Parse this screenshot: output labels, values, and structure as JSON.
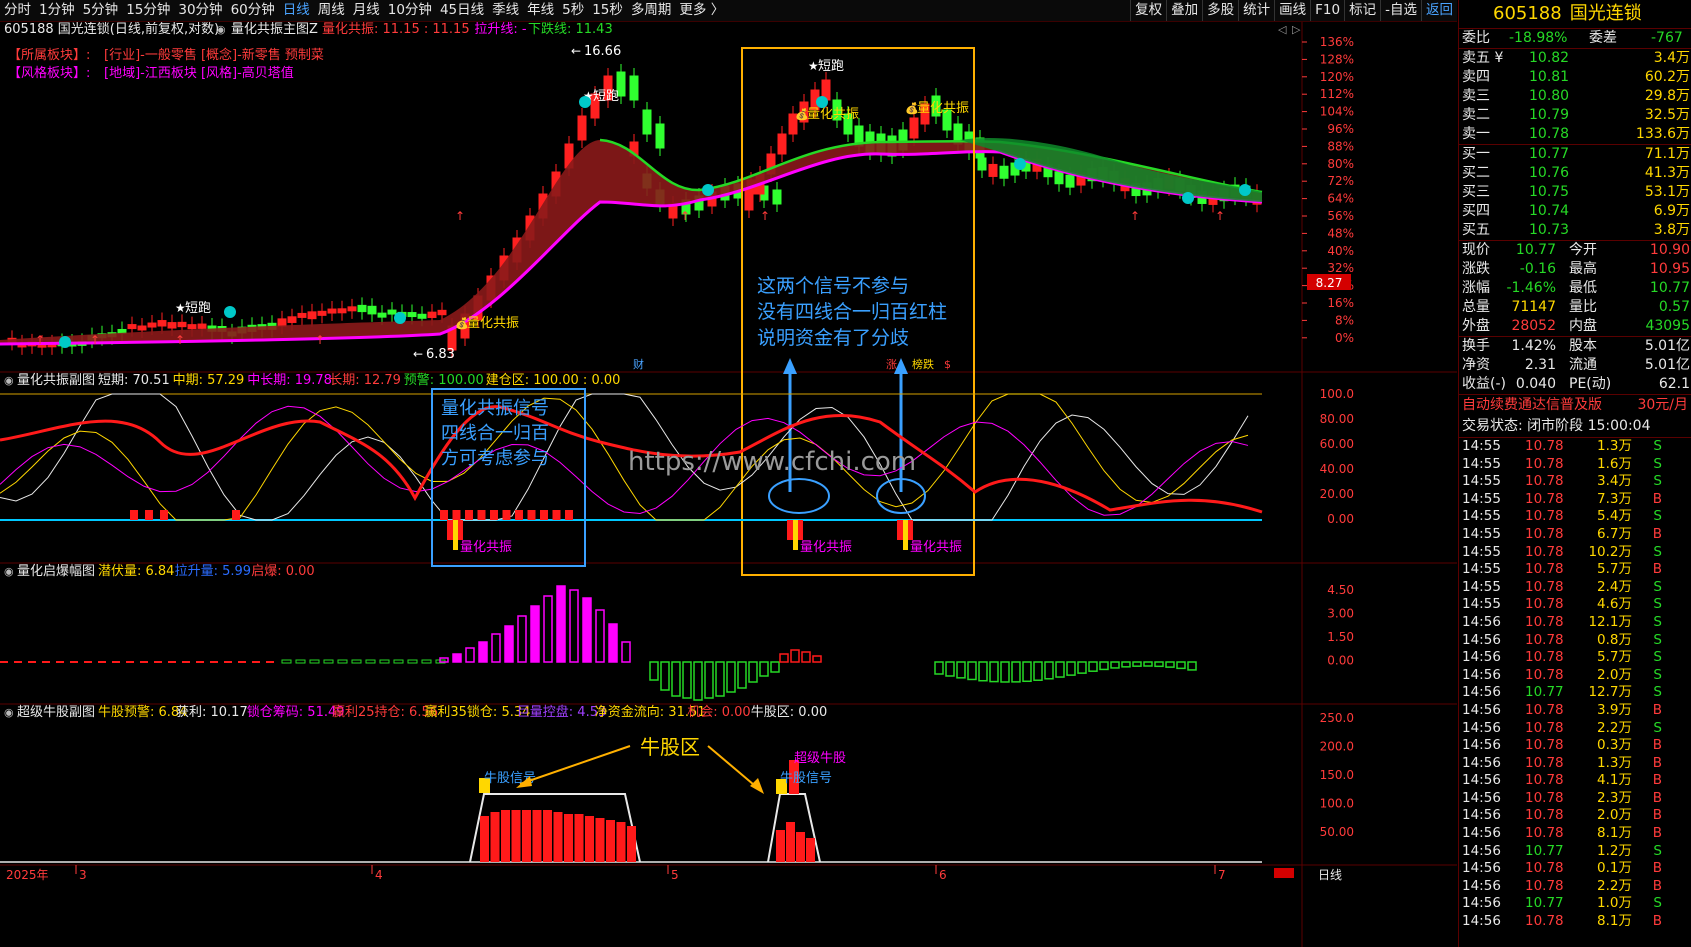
{
  "periods": [
    "分时",
    "1分钟",
    "5分钟",
    "15分钟",
    "30分钟",
    "60分钟",
    "日线",
    "周线",
    "月线",
    "10分钟",
    "45日线",
    "季线",
    "年线",
    "5秒",
    "15秒",
    "多周期",
    "更多 〉"
  ],
  "active_period": "日线",
  "top_buttons": [
    "复权",
    "叠加",
    "多股",
    "统计",
    "画线",
    "F10",
    "标记",
    "-自选",
    "返回"
  ],
  "main_pane": {
    "title": "605188 国光连锁(日线,前复权,对数)",
    "indicator": "量化共振主图Z",
    "params": [
      {
        "label": "量化共振: 11.15 : 11.15",
        "color": "#ff3b3b"
      },
      {
        "label": "拉升线: -",
        "color": "#ff00ff"
      },
      {
        "label": "下跌线: 11.43",
        "color": "#26d926"
      }
    ],
    "sector1_label": "【所属板块】:",
    "sector1_value": "[行业]-一般零售 [概念]-新零售 预制菜",
    "sector2_label": "【风格板块】:",
    "sector2_value": "[地域]-江西板块 [风格]-高贝塔值",
    "high_label": "16.66",
    "low_label": "6.83",
    "price_tag": "8.27",
    "pct_axis": [
      "136%",
      "128%",
      "120%",
      "112%",
      "104%",
      "96%",
      "88%",
      "80%",
      "72%",
      "64%",
      "56%",
      "48%",
      "40%",
      "32%",
      "24%",
      "16%",
      "8%",
      "0%"
    ],
    "annotations": {
      "duanpao": "短跑",
      "gongzhen": "量化共振",
      "cai": "财",
      "zhang": "涨",
      "bangdie": "榜跌"
    },
    "yellow_box_text": [
      "这两个信号不参与",
      "没有四线合一归百红柱",
      "说明资金有了分歧"
    ]
  },
  "pane2": {
    "name": "量化共振副图",
    "params": [
      {
        "label": "短期: 70.51",
        "color": "#e8e8e8"
      },
      {
        "label": "中期: 57.29",
        "color": "#ffd700"
      },
      {
        "label": "中长期: 19.78",
        "color": "#ff00ff"
      },
      {
        "label": "长期: 12.79",
        "color": "#ff3b3b"
      },
      {
        "label": "预警: 100.00",
        "color": "#26d926"
      },
      {
        "label": "建仓区: 100.00 : 0.00",
        "color": "#ffd700"
      }
    ],
    "axis": [
      "100.0",
      "80.00",
      "60.00",
      "40.00",
      "20.00",
      "0.00"
    ],
    "blue_box_text": [
      "量化共振信号",
      "四线合一归百",
      "方可考虑参与"
    ],
    "signal_label": "量化共振"
  },
  "pane3": {
    "name": "量化启爆幅图",
    "params": [
      {
        "label": "潜伏量: 6.84",
        "color": "#ffd700"
      },
      {
        "label": "拉升量: 5.99",
        "color": "#2b6cff"
      },
      {
        "label": "启爆: 0.00",
        "color": "#ff3b3b"
      }
    ],
    "axis": [
      "4.50",
      "3.00",
      "1.50",
      "0.00"
    ]
  },
  "pane4": {
    "name": "超级牛股副图",
    "params": [
      {
        "label": "牛股预警: 6.84",
        "color": "#ffd700"
      },
      {
        "label": "获利: 10.17",
        "color": "#e8e8e8"
      },
      {
        "label": "锁仓筹码: 51.49",
        "color": "#ff00ff"
      },
      {
        "label": "赢利25持仓: 6.56",
        "color": "#ff3b3b"
      },
      {
        "label": "赢利35锁仓: 5.34",
        "color": "#ffd700"
      },
      {
        "label": "巨量控盘: 4.53",
        "color": "#a040ff"
      },
      {
        "label": "净资金流向: 31.51",
        "color": "#ffd700"
      },
      {
        "label": "机会: 0.00",
        "color": "#ff3b3b"
      },
      {
        "label": "牛股区: 0.00",
        "color": "#e8e8e8"
      }
    ],
    "axis": [
      "250.0",
      "200.0",
      "150.0",
      "100.0",
      "50.00"
    ],
    "zone_label": "牛股区",
    "signal_label": "牛股信号",
    "super_label": "超级牛股"
  },
  "watermark": "https://www.cfchi.com",
  "x_axis": {
    "year": "2025年",
    "months": [
      "3",
      "4",
      "5",
      "6",
      "7"
    ],
    "mode": "日线"
  },
  "quote": {
    "code": "605188",
    "name": "国光连锁",
    "webi_label": "委比",
    "webi": "-18.98%",
    "weicha_label": "委差",
    "weicha": "-767",
    "asks": [
      {
        "label": "卖五 ¥",
        "price": "10.82",
        "vol": "3.4万"
      },
      {
        "label": "卖四",
        "price": "10.81",
        "vol": "60.2万"
      },
      {
        "label": "卖三",
        "price": "10.80",
        "vol": "29.8万"
      },
      {
        "label": "卖二",
        "price": "10.79",
        "vol": "32.5万"
      },
      {
        "label": "卖一",
        "price": "10.78",
        "vol": "133.6万"
      }
    ],
    "bids": [
      {
        "label": "买一",
        "price": "10.77",
        "vol": "71.1万"
      },
      {
        "label": "买二",
        "price": "10.76",
        "vol": "41.3万"
      },
      {
        "label": "买三",
        "price": "10.75",
        "vol": "53.1万"
      },
      {
        "label": "买四",
        "price": "10.74",
        "vol": "6.9万"
      },
      {
        "label": "买五",
        "price": "10.73",
        "vol": "3.8万"
      }
    ],
    "stats": [
      {
        "l1": "现价",
        "v1": "10.77",
        "c1": "green",
        "l2": "今开",
        "v2": "10.90",
        "c2": "red"
      },
      {
        "l1": "涨跌",
        "v1": "-0.16",
        "c1": "green",
        "l2": "最高",
        "v2": "10.95",
        "c2": "red"
      },
      {
        "l1": "涨幅",
        "v1": "-1.46%",
        "c1": "green",
        "l2": "最低",
        "v2": "10.77",
        "c2": "green"
      },
      {
        "l1": "总量",
        "v1": "71147",
        "c1": "yellow",
        "l2": "量比",
        "v2": "0.57",
        "c2": "green"
      },
      {
        "l1": "外盘",
        "v1": "28052",
        "c1": "red",
        "l2": "内盘",
        "v2": "43095",
        "c2": "green"
      }
    ],
    "stats2": [
      {
        "l1": "换手",
        "v1": "1.42%",
        "l2": "股本",
        "v2": "5.01亿"
      },
      {
        "l1": "净资",
        "v1": "2.31",
        "l2": "流通",
        "v2": "5.01亿"
      },
      {
        "l1": "收益(-)",
        "v1": "0.040",
        "l2": "PE(动)",
        "v2": "62.1"
      }
    ],
    "promo": "自动续费通达信普及版",
    "promo_price": "30元/月",
    "trade_status": "交易状态: 闭市阶段 15:00:04",
    "ticks": [
      {
        "t": "14:55",
        "p": "10.78",
        "v": "1.3万",
        "s": "S"
      },
      {
        "t": "14:55",
        "p": "10.78",
        "v": "1.6万",
        "s": "S"
      },
      {
        "t": "14:55",
        "p": "10.78",
        "v": "3.4万",
        "s": "S"
      },
      {
        "t": "14:55",
        "p": "10.78",
        "v": "7.3万",
        "s": "B"
      },
      {
        "t": "14:55",
        "p": "10.78",
        "v": "5.4万",
        "s": "S"
      },
      {
        "t": "14:55",
        "p": "10.78",
        "v": "6.7万",
        "s": "B"
      },
      {
        "t": "14:55",
        "p": "10.78",
        "v": "10.2万",
        "s": "S"
      },
      {
        "t": "14:55",
        "p": "10.78",
        "v": "5.7万",
        "s": "B"
      },
      {
        "t": "14:55",
        "p": "10.78",
        "v": "2.4万",
        "s": "S"
      },
      {
        "t": "14:55",
        "p": "10.78",
        "v": "4.6万",
        "s": "S"
      },
      {
        "t": "14:56",
        "p": "10.78",
        "v": "12.1万",
        "s": "S"
      },
      {
        "t": "14:56",
        "p": "10.78",
        "v": "0.8万",
        "s": "S"
      },
      {
        "t": "14:56",
        "p": "10.78",
        "v": "5.7万",
        "s": "S"
      },
      {
        "t": "14:56",
        "p": "10.78",
        "v": "2.0万",
        "s": "S"
      },
      {
        "t": "14:56",
        "p": "10.77",
        "v": "12.7万",
        "s": "S"
      },
      {
        "t": "14:56",
        "p": "10.78",
        "v": "3.9万",
        "s": "B"
      },
      {
        "t": "14:56",
        "p": "10.78",
        "v": "2.2万",
        "s": "S"
      },
      {
        "t": "14:56",
        "p": "10.78",
        "v": "0.3万",
        "s": "B"
      },
      {
        "t": "14:56",
        "p": "10.78",
        "v": "1.3万",
        "s": "B"
      },
      {
        "t": "14:56",
        "p": "10.78",
        "v": "4.1万",
        "s": "B"
      },
      {
        "t": "14:56",
        "p": "10.78",
        "v": "2.3万",
        "s": "B"
      },
      {
        "t": "14:56",
        "p": "10.78",
        "v": "2.0万",
        "s": "B"
      },
      {
        "t": "14:56",
        "p": "10.78",
        "v": "8.1万",
        "s": "B"
      },
      {
        "t": "14:56",
        "p": "10.77",
        "v": "1.2万",
        "s": "S"
      },
      {
        "t": "14:56",
        "p": "10.78",
        "v": "0.1万",
        "s": "B"
      },
      {
        "t": "14:56",
        "p": "10.78",
        "v": "2.2万",
        "s": "B"
      },
      {
        "t": "14:56",
        "p": "10.77",
        "v": "1.0万",
        "s": "S"
      },
      {
        "t": "14:56",
        "p": "10.78",
        "v": "8.1万",
        "s": "B"
      }
    ],
    "bottom_mode": "日线"
  }
}
